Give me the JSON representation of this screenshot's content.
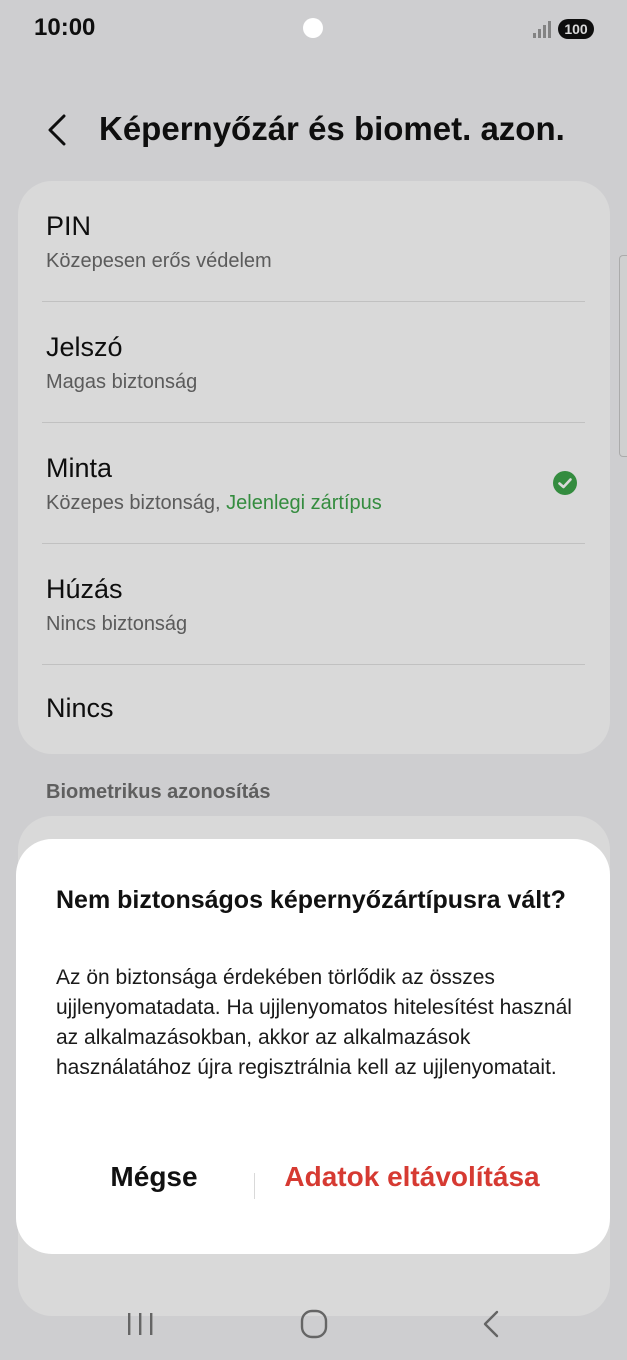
{
  "status_bar": {
    "time": "10:00",
    "battery": "100",
    "signal_icon": "signal-icon"
  },
  "header": {
    "title": "Képernyőzár és biomet. azon.",
    "back_icon": "back-chevron-icon"
  },
  "lock_types": [
    {
      "title": "PIN",
      "subtitle": "Közepesen erős védelem"
    },
    {
      "title": "Jelszó",
      "subtitle": "Magas biztonság"
    },
    {
      "title": "Minta",
      "subtitle": "Közepes biztonság,",
      "current": "Jelenlegi zártípus",
      "selected": true
    },
    {
      "title": "Húzás",
      "subtitle": "Nincs biztonság"
    },
    {
      "title": "Nincs"
    }
  ],
  "section": {
    "biometrics_label": "Biometrikus azonosítás"
  },
  "dialog": {
    "title": "Nem biztonságos képernyőzártípusra vált?",
    "body": "Az ön biztonsága érdekében törlődik az összes ujjlenyomatadata. Ha ujjlenyomatos hitelesítést használ az alkalmazásokban, akkor az alkalmazások használatához újra regisztrálnia kell az ujjlenyomatait.",
    "cancel_label": "Mégse",
    "confirm_label": "Adatok eltávolítása"
  },
  "nav_bar": {
    "recents_icon": "recents-icon",
    "home_icon": "home-icon",
    "back_icon": "nav-back-icon"
  },
  "colors": {
    "accent_green": "#3ea54a",
    "destructive_red": "#d63a32",
    "card_background": "#ffffff",
    "page_background": "#f3f3f5"
  }
}
